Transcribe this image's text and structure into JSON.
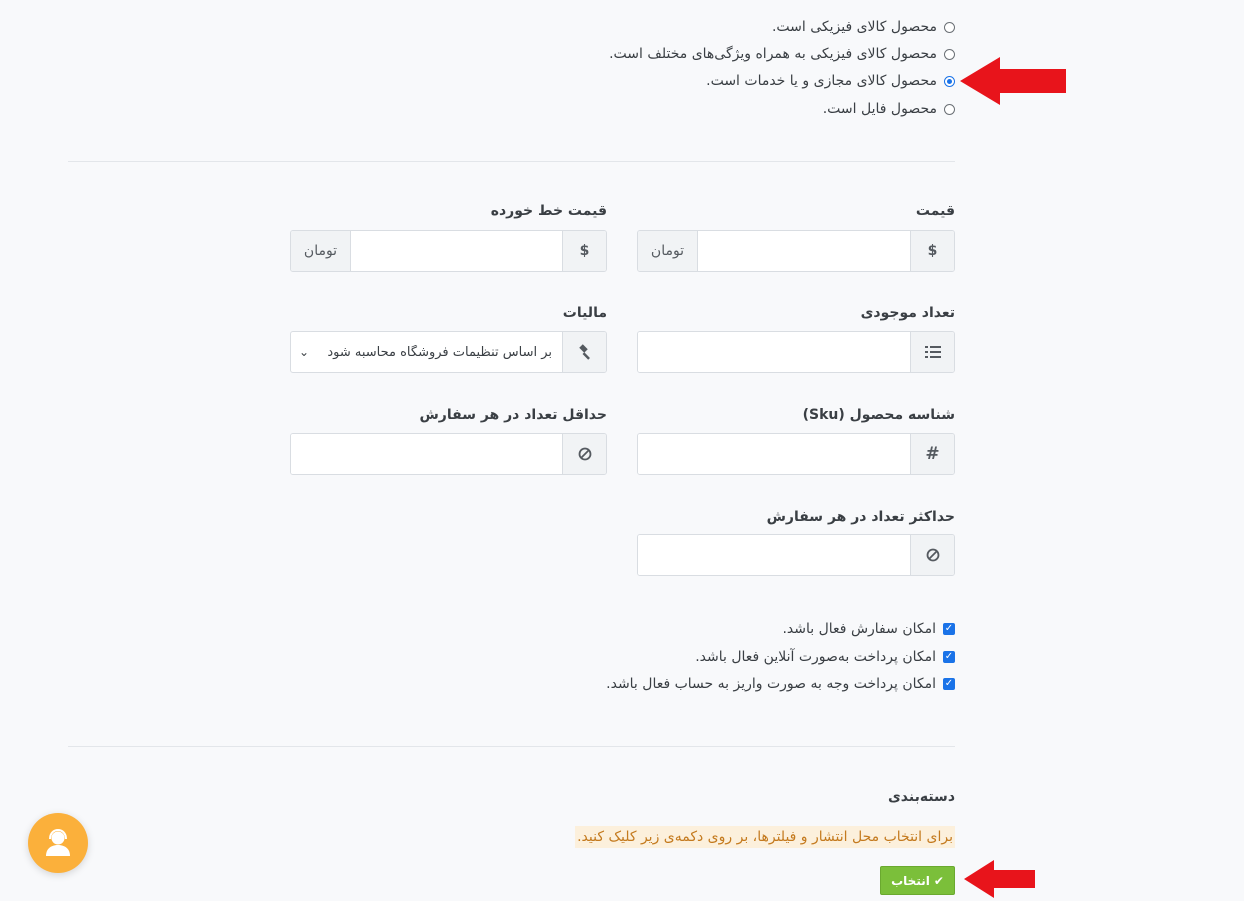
{
  "product_type": {
    "options": [
      {
        "label": "محصول کالای فیزیکی است.",
        "selected": false
      },
      {
        "label": "محصول کالای فیزیکی به همراه ویژگی‌های مختلف است.",
        "selected": false
      },
      {
        "label": "محصول کالای مجازی و یا خدمات است.",
        "selected": true
      },
      {
        "label": "محصول فایل است.",
        "selected": false
      }
    ]
  },
  "price": {
    "label": "قیمت",
    "currency_symbol": "$",
    "unit": "تومان",
    "value": ""
  },
  "old_price": {
    "label": "قیمت خط خورده",
    "currency_symbol": "$",
    "unit": "تومان",
    "value": ""
  },
  "stock": {
    "label": "تعداد موجودی",
    "value": ""
  },
  "tax": {
    "label": "مالیات",
    "selected": "بر اساس تنظیمات فروشگاه محاسبه شود"
  },
  "sku": {
    "label": "شناسه محصول (Sku)",
    "value": ""
  },
  "min_order": {
    "label": "حداقل تعداد در هر سفارش",
    "value": ""
  },
  "max_order": {
    "label": "حداکثر تعداد در هر سفارش",
    "value": ""
  },
  "options": [
    {
      "label": "امکان سفارش فعال باشد.",
      "checked": true
    },
    {
      "label": "امکان پرداخت به‌صورت آنلاین فعال باشد.",
      "checked": true
    },
    {
      "label": "امکان پرداخت وجه به صورت واریز به حساب فعال باشد.",
      "checked": true
    }
  ],
  "category": {
    "label": "دسته‌بندی",
    "hint": "برای انتخاب محل انتشار و فیلترها، بر روی دکمه‌ی زیر کلیک کنید.",
    "button_label": "انتخاب"
  },
  "colors": {
    "accent": "#1a73e8",
    "button": "#7bbf3a",
    "arrow": "#e8141b",
    "support": "#fbb03b",
    "hint_bg": "#fcf0dc",
    "hint_text": "#c47a1e"
  }
}
